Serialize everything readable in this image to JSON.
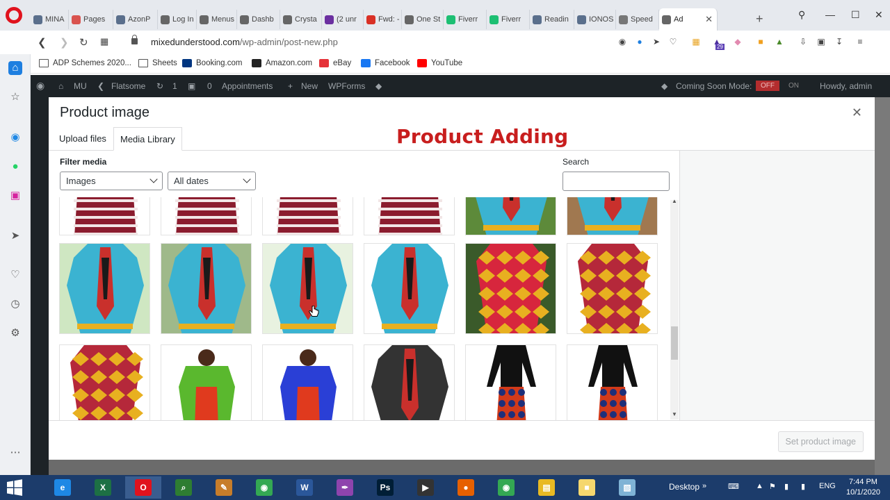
{
  "browser": {
    "tabs": [
      {
        "label": "MINA",
        "icon": "wordpress-icon",
        "color": "#5a6f8c"
      },
      {
        "label": "Pages",
        "icon": "pages-icon",
        "color": "#d9534f"
      },
      {
        "label": "AzonP",
        "icon": "wordpress-icon",
        "color": "#5a6f8c"
      },
      {
        "label": "Log In",
        "icon": "document-icon",
        "color": "#666666"
      },
      {
        "label": "Menus",
        "icon": "document-icon",
        "color": "#666666"
      },
      {
        "label": "Dashb",
        "icon": "document-icon",
        "color": "#666666"
      },
      {
        "label": "Crysta",
        "icon": "document-icon",
        "color": "#666666"
      },
      {
        "label": "(2 unr",
        "icon": "mail-icon",
        "color": "#6b2fa0"
      },
      {
        "label": "Fwd: -",
        "icon": "gmail-icon",
        "color": "#d93025"
      },
      {
        "label": "One St",
        "icon": "document-icon",
        "color": "#666666"
      },
      {
        "label": "Fiverr",
        "icon": "fiverr-icon",
        "color": "#1dbf73"
      },
      {
        "label": "Fiverr",
        "icon": "fiverr-icon",
        "color": "#1dbf73"
      },
      {
        "label": "Readin",
        "icon": "wordpress-icon",
        "color": "#5a6f8c"
      },
      {
        "label": "IONOS",
        "icon": "wordpress-icon",
        "color": "#5a6f8c"
      },
      {
        "label": "Speed",
        "icon": "grid-icon",
        "color": "#777777"
      },
      {
        "label": "Ad",
        "icon": "document-icon",
        "color": "#666666",
        "active": true
      }
    ],
    "url_domain": "mixedunderstood.com",
    "url_path": "/wp-admin/post-new.php",
    "bookmarks": [
      {
        "label": "ADP Schemes 2020...",
        "icon": "folder-icon"
      },
      {
        "label": "Sheets",
        "icon": "folder-icon"
      },
      {
        "label": "Booking.com",
        "icon": "booking-icon"
      },
      {
        "label": "Amazon.com",
        "icon": "amazon-icon"
      },
      {
        "label": "eBay",
        "icon": "ebay-icon"
      },
      {
        "label": "Facebook",
        "icon": "facebook-icon"
      },
      {
        "label": "YouTube",
        "icon": "youtube-icon"
      }
    ],
    "extension_badge": "29"
  },
  "adminbar": {
    "site": "MU",
    "theme": "Flatsome",
    "updates": "1",
    "comments": "0",
    "appointments": "Appointments",
    "new": "New",
    "wpforms": "WPForms",
    "coming_soon": "Coming Soon Mode:",
    "off": "OFF",
    "on": "ON",
    "howdy": "Howdy, admin"
  },
  "modal": {
    "title": "Product image",
    "tabs": [
      "Upload files",
      "Media Library"
    ],
    "active_tab": "Media Library",
    "overlay_title": "Product Adding",
    "filter_label": "Filter media",
    "filter_type": "Images",
    "filter_date": "All dates",
    "search_label": "Search",
    "search_value": "",
    "set_button": "Set product image"
  },
  "taskbar": {
    "desktop": "Desktop",
    "lang": "ENG",
    "time": "7:44 PM",
    "date": "10/1/2020"
  },
  "colors": {
    "overlay_red": "#c81e1e",
    "wp_dark": "#1d2327",
    "taskbar": "#1c3c6b"
  }
}
